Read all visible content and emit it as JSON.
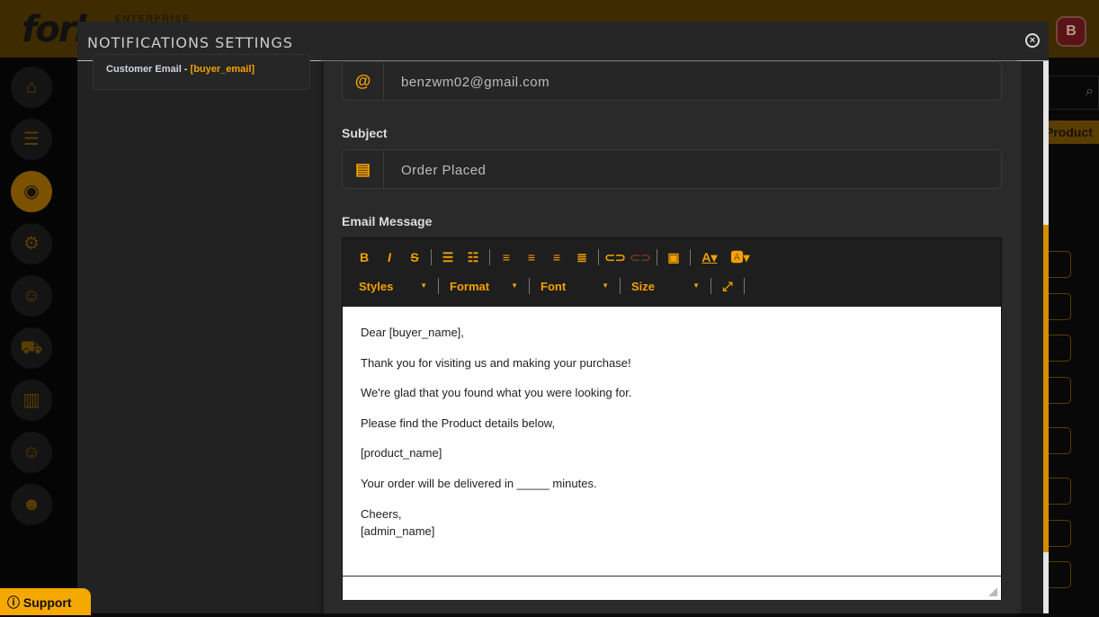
{
  "app": {
    "logo": "fork",
    "logo_sub": "ENTERPRISE",
    "avatar": "B",
    "search_icon": "⌕",
    "bg_product_button": "Product",
    "support": "Support"
  },
  "modal": {
    "title": "NOTIFICATIONS SETTINGS",
    "card": {
      "label": "Customer Email - ",
      "variable": "[buyer_email]"
    },
    "email": {
      "value": "benzwm02@gmail.com"
    },
    "subject": {
      "label": "Subject",
      "value": "Order Placed"
    },
    "message": {
      "label": "Email Message",
      "toolbar": {
        "styles": "Styles",
        "format": "Format",
        "font": "Font",
        "size": "Size"
      },
      "lines": [
        "Dear [buyer_name],",
        "Thank you for visiting us and making your purchase!",
        "We're glad that you found what you were looking for.",
        "Please find the Product details below,",
        "[product_name]",
        "Your order will be delivered in _____ minutes.",
        "Cheers,",
        "[admin_name]"
      ]
    }
  },
  "colors": {
    "accent": "#f5a000",
    "header": "#3f2b00"
  }
}
